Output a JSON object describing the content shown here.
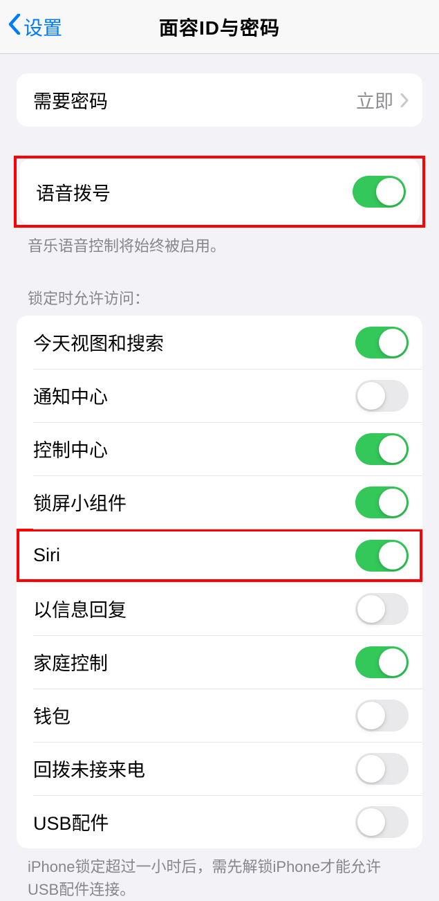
{
  "header": {
    "back_label": "设置",
    "title": "面容ID与密码"
  },
  "require_group": {
    "require_label": "需要密码",
    "require_value": "立即"
  },
  "voice_group": {
    "voice_dial_label": "语音拨号",
    "voice_dial_on": true,
    "footer": "音乐语音控制将始终被启用。"
  },
  "lock_section": {
    "header": "锁定时允许访问：",
    "items": [
      {
        "label": "今天视图和搜索",
        "on": true
      },
      {
        "label": "通知中心",
        "on": false
      },
      {
        "label": "控制中心",
        "on": true
      },
      {
        "label": "锁屏小组件",
        "on": true
      },
      {
        "label": "Siri",
        "on": true
      },
      {
        "label": "以信息回复",
        "on": false
      },
      {
        "label": "家庭控制",
        "on": true
      },
      {
        "label": "钱包",
        "on": false
      },
      {
        "label": "回拨未接来电",
        "on": false
      },
      {
        "label": "USB配件",
        "on": false
      }
    ],
    "footer": "iPhone锁定超过一小时后，需先解锁iPhone才能允许USB配件连接。"
  }
}
